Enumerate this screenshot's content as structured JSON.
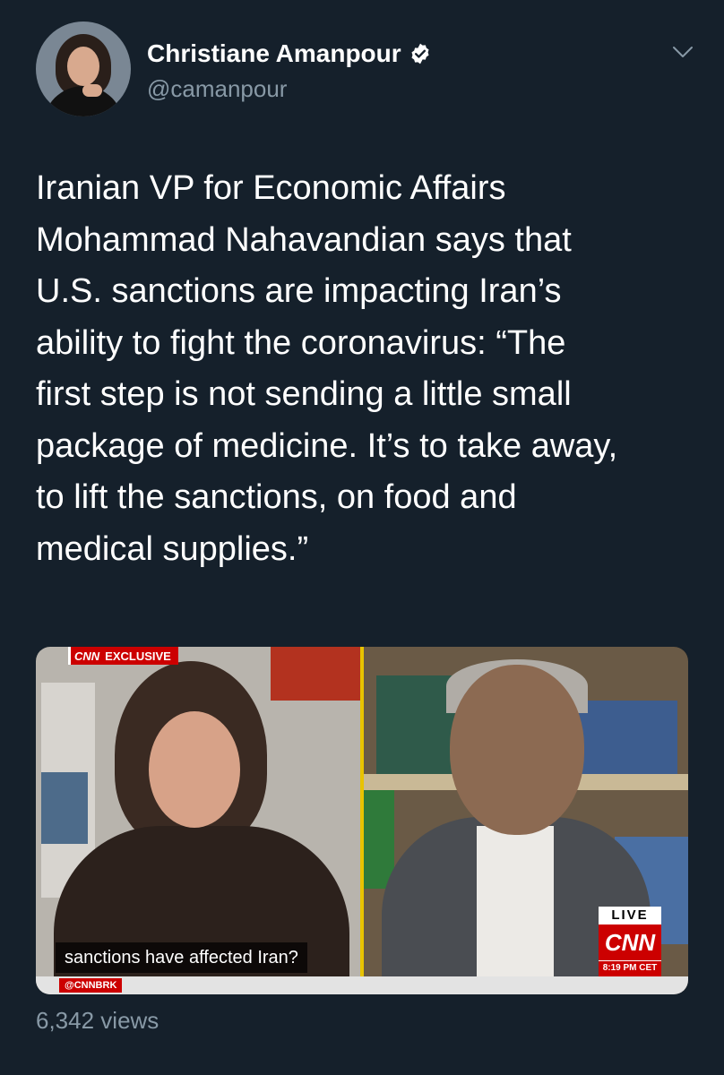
{
  "author": {
    "name": "Christiane Amanpour",
    "handle": "@camanpour",
    "verified": true,
    "avatar_icon": "profile-photo"
  },
  "tweet": {
    "text_lines": [
      "Iranian VP for Economic Affairs",
      "Mohammad Nahavandian says that",
      "U.S. sanctions are impacting Iran’s",
      "ability to fight the coronavirus: “The",
      "first step is not sending a little small",
      "package of medicine. It’s to take away,",
      "to lift the sanctions, on food and",
      "medical supplies.”"
    ]
  },
  "media": {
    "exclusive_logo": "CNN",
    "exclusive_label": "EXCLUSIVE",
    "caption": "sanctions have affected Iran?",
    "ticker_tag": "@CNNBRK",
    "live_label": "LIVE",
    "network_logo": "CNN",
    "time": "8:19 PM CET"
  },
  "stats": {
    "views": "6,342 views"
  },
  "colors": {
    "background": "#15202b",
    "text": "#ffffff",
    "muted": "#8899a6",
    "verified": "#ffffff",
    "cnn_red": "#cc0000"
  },
  "icons": {
    "verified": "verified-badge-icon",
    "menu": "chevron-down-icon"
  }
}
